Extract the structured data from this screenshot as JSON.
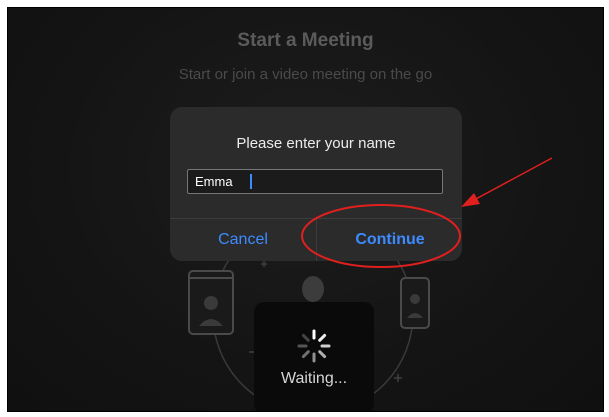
{
  "screen": {
    "title": "Start a Meeting",
    "subtitle": "Start or join a video meeting on the go"
  },
  "dialog": {
    "title": "Please enter your name",
    "name_value": "Emma",
    "cancel_label": "Cancel",
    "continue_label": "Continue"
  },
  "hud": {
    "label": "Waiting..."
  },
  "icons": {
    "tablet": "tablet-icon",
    "phone": "phone-icon",
    "person": "person-icon",
    "spinner": "spinner-icon"
  },
  "colors": {
    "accent": "#3d8bff",
    "annotation": "#e0201e",
    "dialog_bg": "#2b2b2b",
    "screen_bg": "#141414"
  }
}
